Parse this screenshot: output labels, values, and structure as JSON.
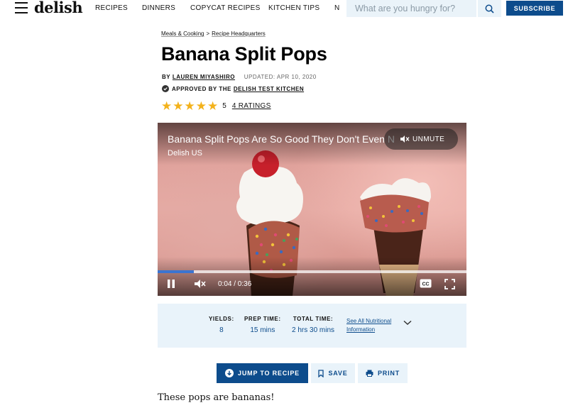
{
  "header": {
    "logo": "delish",
    "nav": [
      "RECIPES",
      "DINNERS",
      "COPYCAT RECIPES",
      "KITCHEN TIPS",
      "N"
    ],
    "search_placeholder": "What are you hungry for?",
    "subscribe_label": "SUBSCRIBE"
  },
  "breadcrumb": {
    "items": [
      "Meals & Cooking",
      "Recipe Headquarters"
    ],
    "separator": ">"
  },
  "article": {
    "title": "Banana Split Pops",
    "by_label": "BY",
    "author": "LAUREN MIYASHIRO",
    "updated": "UPDATED: APR 10, 2020",
    "approved_label": "APPROVED BY THE",
    "approved_by": "DELISH TEST KITCHEN",
    "rating_value": "5",
    "rating_count": "4 RATINGS",
    "stars": 5,
    "intro": "These pops are bananas!"
  },
  "video": {
    "title": "Banana Split Pops Are So Good They Don't Even N",
    "channel": "Delish US",
    "unmute_label": "UNMUTE",
    "time": "0:04 / 0:36",
    "progress_fraction": 0.118
  },
  "recipe_info": {
    "yields_label": "YIELDS:",
    "yields_value": "8",
    "prep_label": "PREP TIME:",
    "prep_value": "15 mins",
    "total_label": "TOTAL TIME:",
    "total_value": "2 hrs 30 mins",
    "nutrition_line1": "See All Nutritional",
    "nutrition_line2": "Information"
  },
  "actions": {
    "jump_label": "JUMP TO RECIPE",
    "save_label": "SAVE",
    "print_label": "PRINT"
  },
  "colors": {
    "brand_blue": "#0d4c8c",
    "light_blue_bg": "#e9f3fa",
    "star_gold": "#f3b21b",
    "progress_blue": "#3b74d1"
  }
}
